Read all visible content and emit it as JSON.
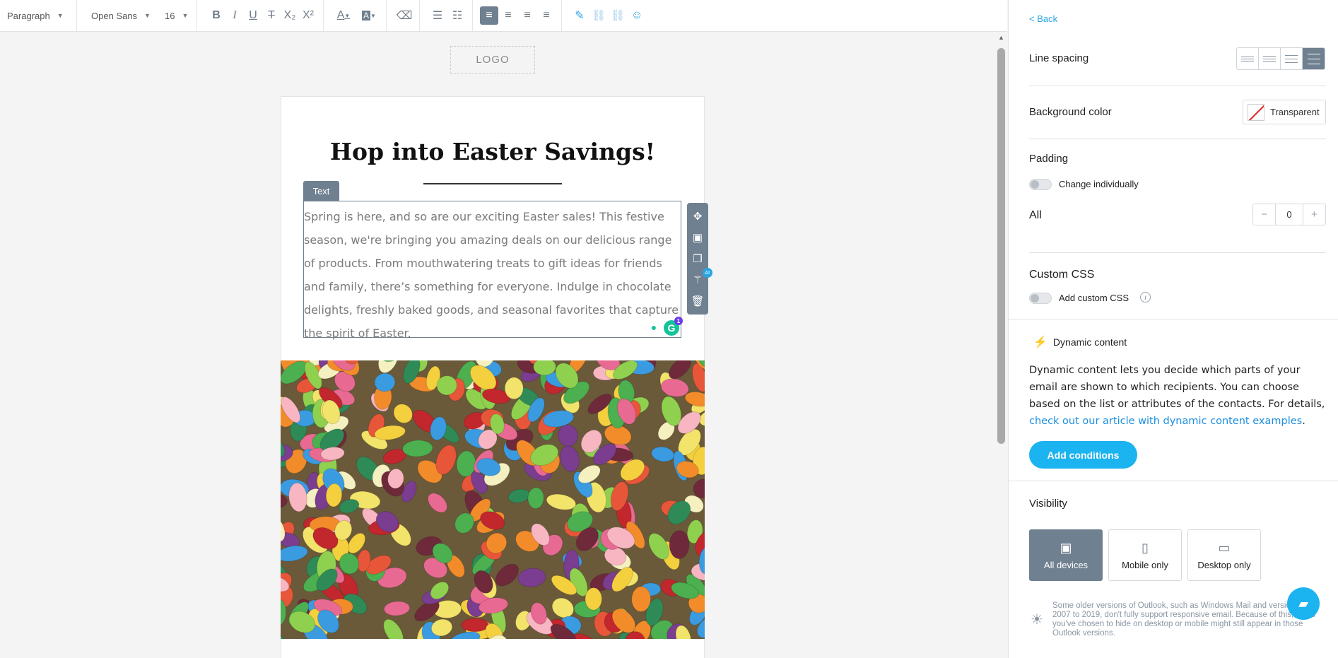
{
  "toolbar": {
    "paragraph_style": "Paragraph",
    "font_family": "Open Sans",
    "font_size": "16",
    "buttons": {
      "bold": "B",
      "italic": "I",
      "underline": "U",
      "strike": "T",
      "subscript": "X₂",
      "superscript": "X²",
      "font_color": "A",
      "bg_color": "A",
      "clear_format": "⌫",
      "ordered_list": "☰",
      "bullet_list": "☷",
      "align_left": "≡",
      "align_center": "≡",
      "align_right": "≡",
      "align_justify": "≡",
      "link": "✎",
      "unlink": "⛓",
      "unlink2": "⛓",
      "emoji": "☺"
    }
  },
  "canvas": {
    "logo_placeholder": "LOGO",
    "headline": "Hop into Easter Savings!",
    "text_tag": "Text",
    "body_text": "Spring is here, and so are our exciting Easter sales! This festive season, we're bringing you amazing deals on our delicious range of products. From mouthwatering treats to gift ideas for friends and family, there’s something for everyone. Indulge in chocolate delights, freshly baked goods, and seasonal favorites that capture the spirit of Easter.",
    "grammarly_badge": "1",
    "ai_badge": "AI",
    "hero_image_alt": "Colorful jelly beans"
  },
  "panel": {
    "back": "< Back",
    "line_spacing_label": "Line spacing",
    "background_color_label": "Background color",
    "background_color_value": "Transparent",
    "padding_label": "Padding",
    "change_individually": "Change individually",
    "all_label": "All",
    "padding_value": "0",
    "minus": "−",
    "plus": "+",
    "custom_css_label": "Custom CSS",
    "add_custom_css": "Add custom CSS",
    "dynamic_title": "Dynamic content",
    "dynamic_desc": "Dynamic content lets you decide which parts of your email are shown to which recipients. You can choose based on the list or attributes of the contacts. For details, ",
    "dynamic_link": "check out our article with dynamic content examples",
    "dynamic_end": ".",
    "add_conditions": "Add conditions",
    "visibility_label": "Visibility",
    "vis_all": "All devices",
    "vis_mobile": "Mobile only",
    "vis_desktop": "Desktop only",
    "note": "Some older versions of Outlook, such as Windows Mail and versions from 2007 to 2019, don't fully support responsive email. Because of this, items you've chosen to hide on desktop or mobile might still appear in those Outlook versions."
  },
  "colors": {
    "accent": "#1bb3f0",
    "tool_gray": "#6f8090",
    "link_blue": "#1b8fe0"
  }
}
